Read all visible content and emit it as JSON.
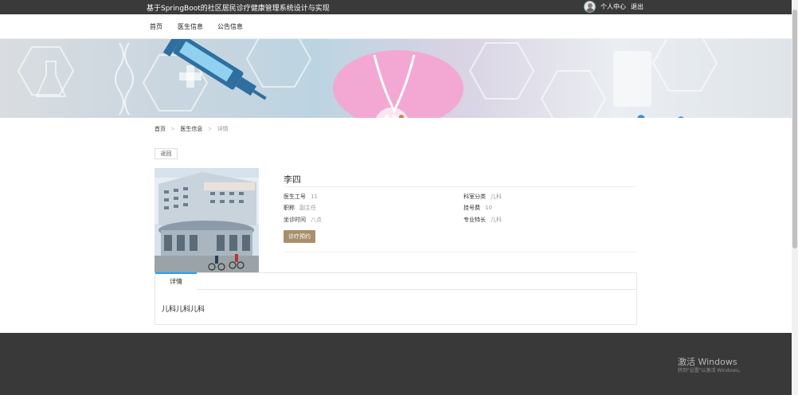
{
  "header": {
    "site_title": "基于SpringBoot的社区居民诊疗健康管理系统设计与实现",
    "user_center": "个人中心",
    "logout": "退出"
  },
  "nav": {
    "items": [
      {
        "label": "首页"
      },
      {
        "label": "医生信息"
      },
      {
        "label": "公告信息"
      }
    ]
  },
  "banner": {
    "slide_count": 3,
    "active_slide": 3
  },
  "breadcrumb": {
    "items": [
      "首页",
      "医生信息",
      "详情"
    ],
    "separator": ">"
  },
  "back_button": "返回",
  "doctor": {
    "name": "李四",
    "fields": {
      "id": {
        "label": "医生工号",
        "value": "11"
      },
      "department": {
        "label": "科室分类",
        "value": "儿科"
      },
      "title": {
        "label": "职称",
        "value": "副主任"
      },
      "fee": {
        "label": "挂号费",
        "value": "10"
      },
      "schedule": {
        "label": "坐诊时间",
        "value": "八点"
      },
      "specialty": {
        "label": "专业特长",
        "value": "儿科"
      }
    },
    "book_button": "诊疗预约"
  },
  "detail": {
    "tab_label": "详情",
    "content": "儿科儿科儿科"
  },
  "watermark": {
    "title": "激活 Windows",
    "subtitle": "转到\"设置\"以激活 Windows。"
  },
  "colors": {
    "topbar": "#3a3a3a",
    "footer": "#393939",
    "accent_tab": "#1e9fff",
    "book_button": "#a88f6b",
    "active_dot": "#c2864a"
  }
}
